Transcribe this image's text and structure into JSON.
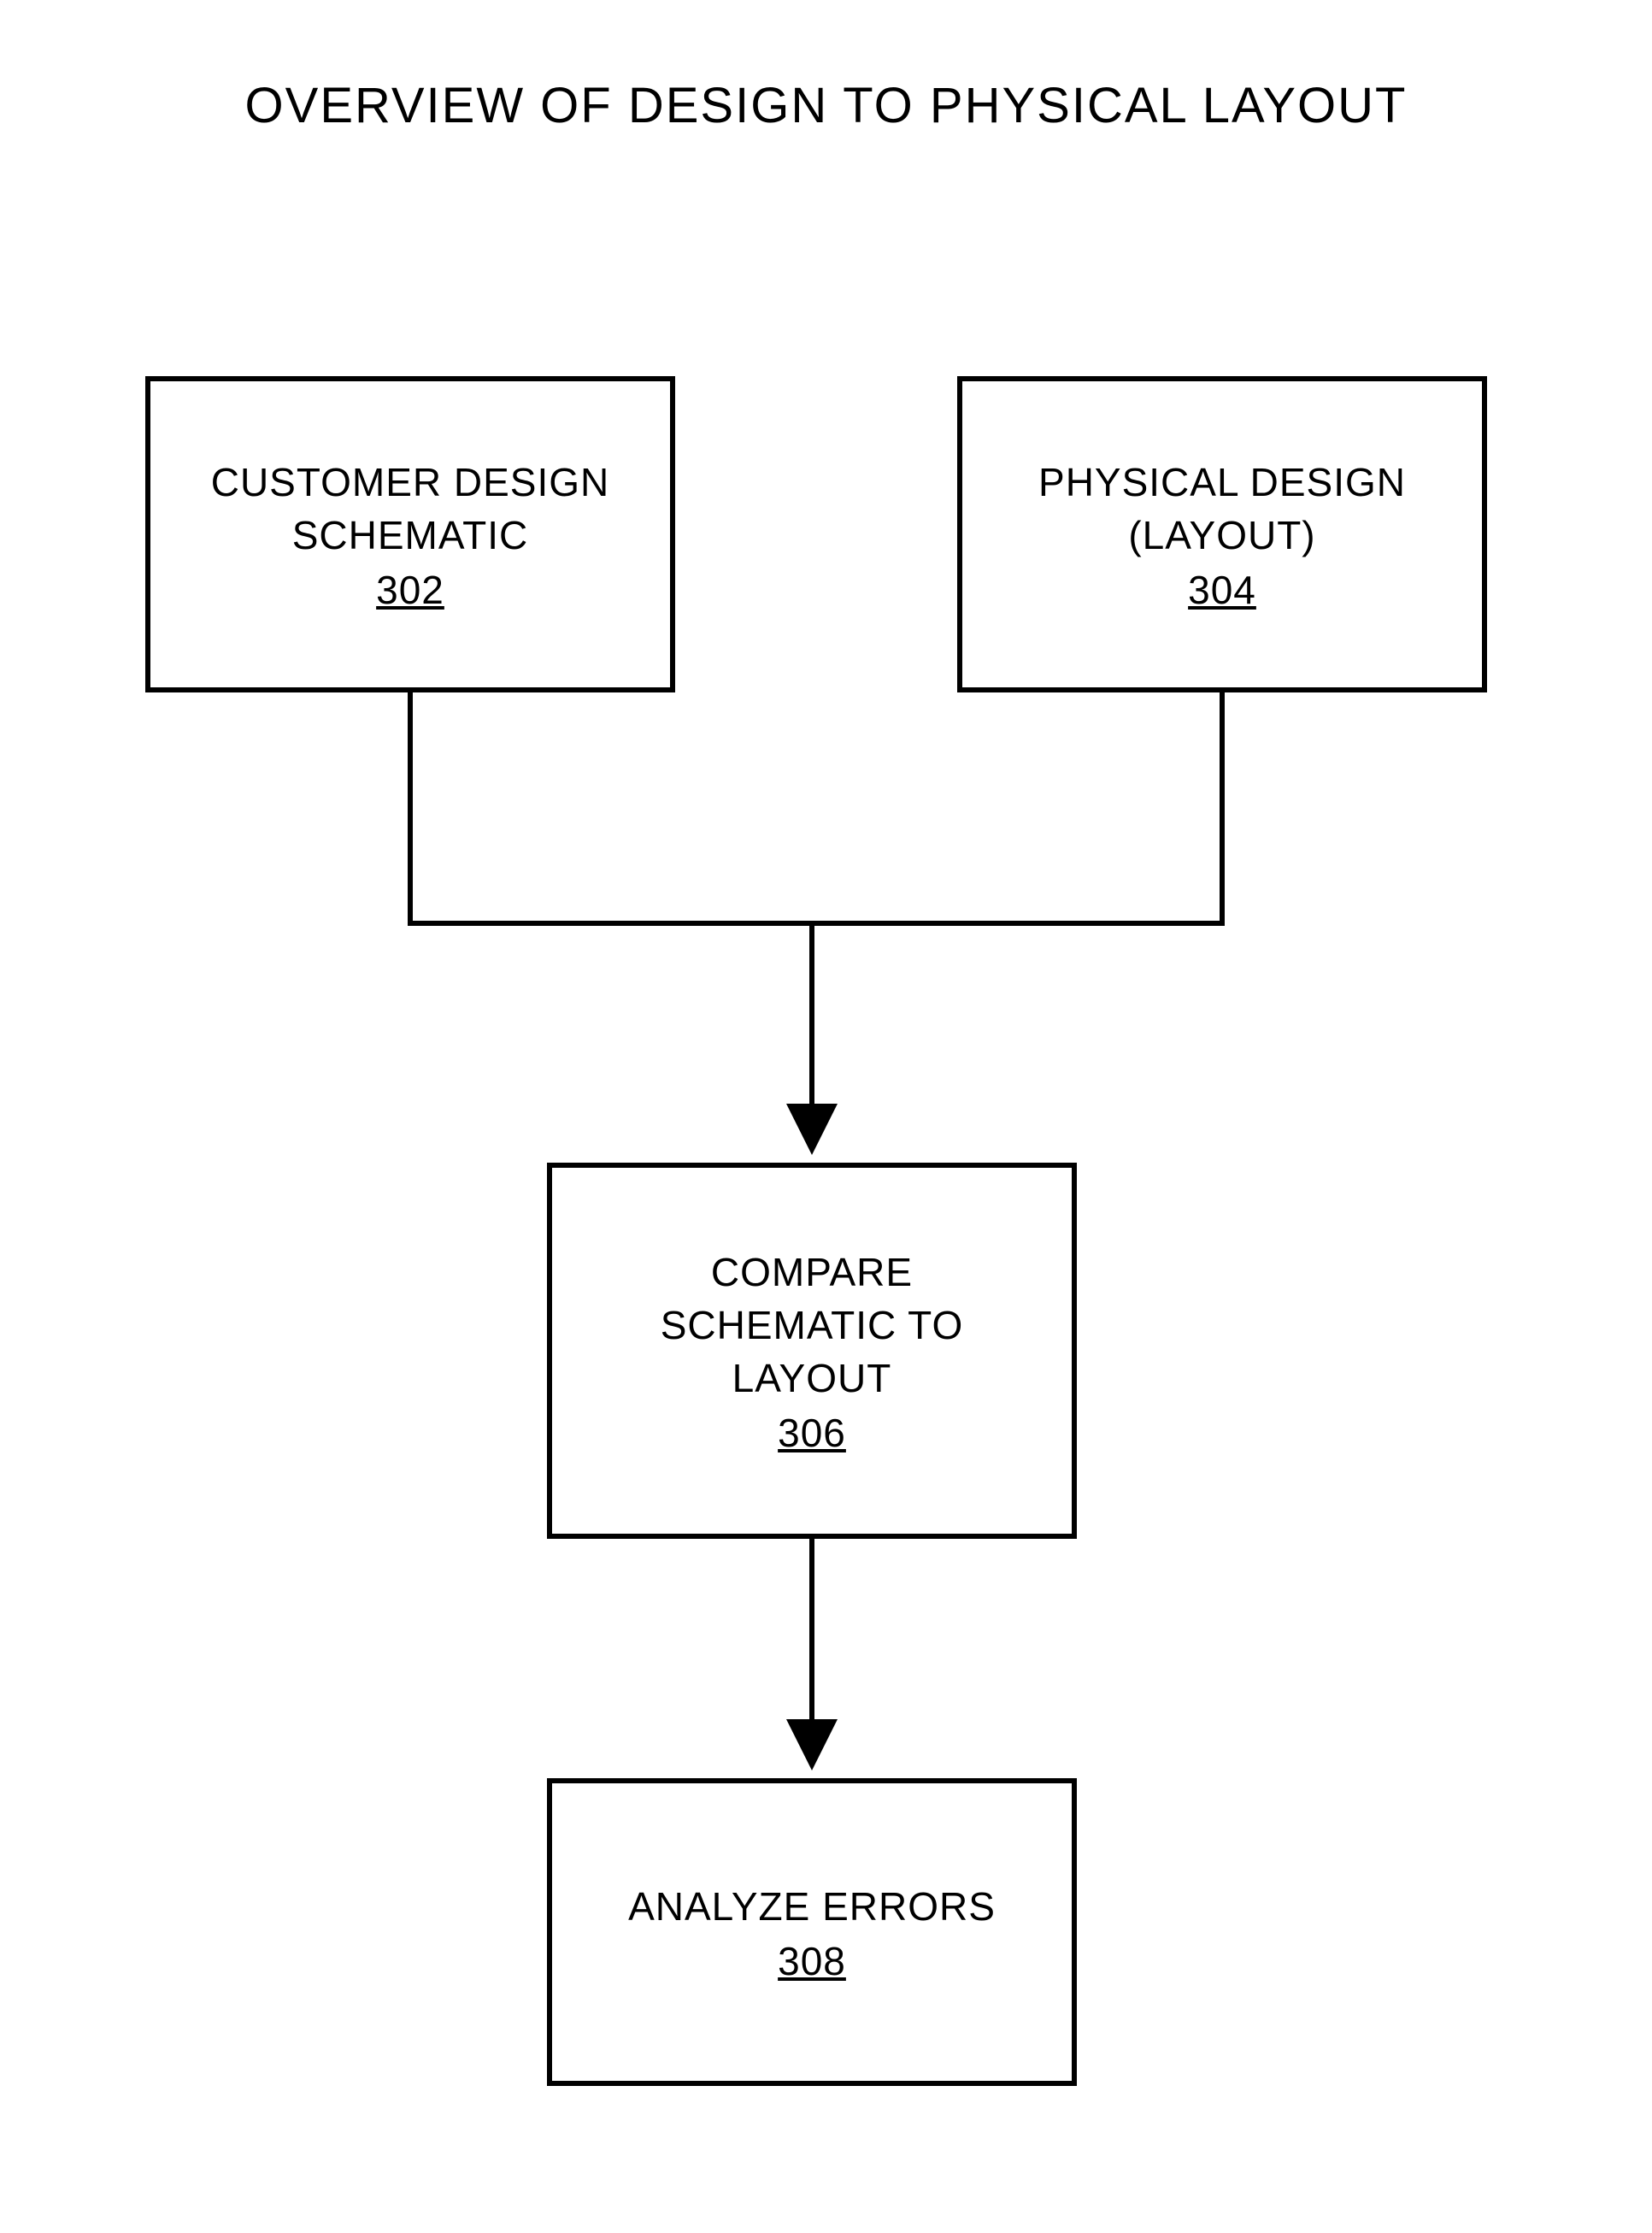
{
  "title": "OVERVIEW OF DESIGN TO PHYSICAL LAYOUT",
  "boxes": {
    "b302": {
      "line1": "CUSTOMER DESIGN",
      "line2": "SCHEMATIC",
      "ref": "302"
    },
    "b304": {
      "line1": "PHYSICAL DESIGN",
      "line2": "(LAYOUT)",
      "ref": "304"
    },
    "b306": {
      "line1": "COMPARE",
      "line2": "SCHEMATIC TO",
      "line3": "LAYOUT",
      "ref": "306"
    },
    "b308": {
      "line1": "ANALYZE ERRORS",
      "ref": "308"
    }
  }
}
